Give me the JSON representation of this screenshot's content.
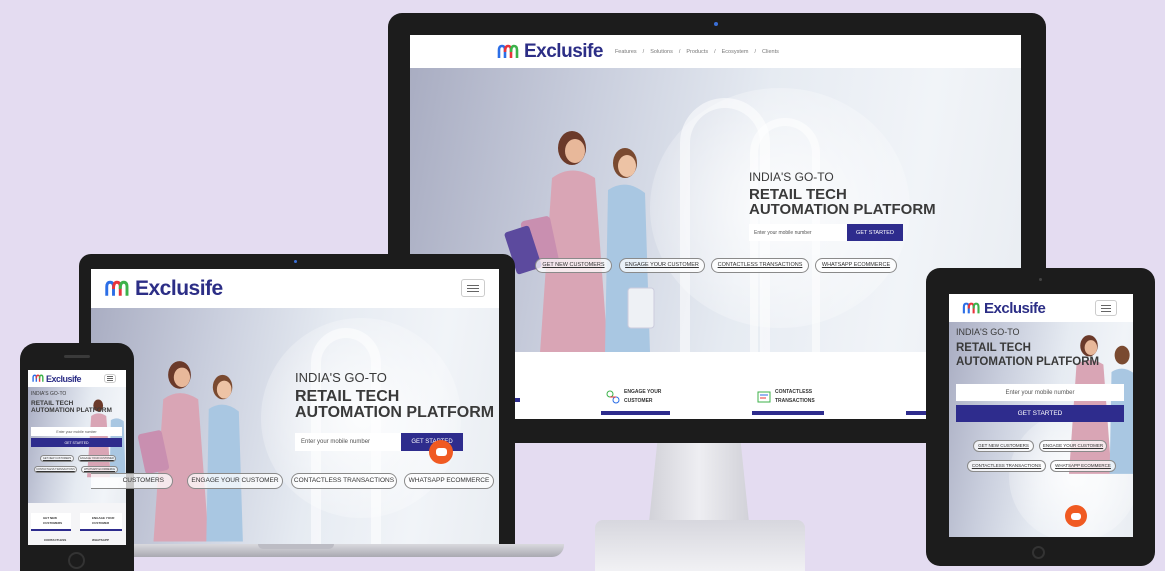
{
  "brand": {
    "name": "Exclusife"
  },
  "nav": {
    "features": "Features",
    "sep1": "/",
    "solutions": "Solutions",
    "sep2": "/",
    "products": "Products",
    "sep3": "/",
    "ecosystem": "Ecosystem",
    "sep4": "/",
    "clients": "Clients"
  },
  "hero": {
    "line1": "INDIA'S GO-TO",
    "line2": "RETAIL TECH",
    "line3": "AUTOMATION PLATFORM",
    "placeholder": "Enter your mobile number",
    "cta": "GET STARTED"
  },
  "pills": [
    "GET NEW CUSTOMERS",
    "ENGAGE YOUR CUSTOMER",
    "CONTACTLESS TRANSACTIONS",
    "WHATSAPP ECOMMERCE"
  ],
  "laptop_pills": [
    "CUSTOMERS",
    "ENGAGE YOUR CUSTOMER",
    "CONTACTLESS TRANSACTIONS",
    "WHATSAPP ECOMMERCE"
  ],
  "cards": {
    "engage_1": "ENGAGE YOUR",
    "engage_2": "CUSTOMER",
    "contactless_1": "CONTACTLESS",
    "contactless_2": "TRANSACTIONS",
    "getnew_1": "GET NEW",
    "getnew_2": "CUSTOMERS",
    "whatsapp": "WHATSAPP"
  },
  "icons": [
    "logo-mark-icon",
    "hamburger-menu-icon",
    "chat-bubble-icon",
    "camera-dot-icon",
    "home-button-icon"
  ],
  "colors": {
    "primary": "#2e2c8d",
    "chat": "#f05a22",
    "background": "#e4dcf1",
    "bezel": "#1c1c1c"
  }
}
